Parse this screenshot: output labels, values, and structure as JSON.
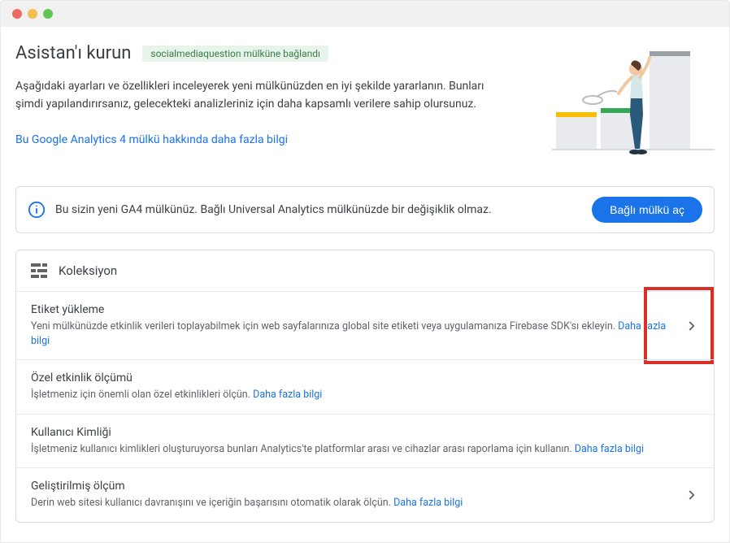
{
  "header": {
    "title": "Asistan'ı kurun",
    "chip": "socialmediaquestion mülküne bağlandı",
    "intro": "Aşağıdaki ayarları ve özellikleri inceleyerek yeni mülkünüzden en iyi şekilde yararlanın. Bunları şimdi yapılandırırsanız, gelecekteki analizleriniz için daha kapsamlı verilere sahip olursunuz.",
    "learn_more": "Bu Google Analytics 4 mülkü hakkında daha fazla bilgi"
  },
  "alert": {
    "text": "Bu sizin yeni GA4 mülkünüz. Bağlı Universal Analytics mülkünüzde bir değişiklik olmaz.",
    "button": "Bağlı mülkü aç"
  },
  "card": {
    "title": "Koleksiyon"
  },
  "items": [
    {
      "title": "Etiket yükleme",
      "desc": "Yeni mülkünüzde etkinlik verileri toplayabilmek için web sayfalarınıza global site etiketi veya uygulamanıza Firebase SDK'sı ekleyin.",
      "more": "Daha fazla bilgi",
      "arrow": true,
      "highlight": true
    },
    {
      "title": "Özel etkinlik ölçümü",
      "desc": "İşletmeniz için önemli olan özel etkinlikleri ölçün.",
      "more": "Daha fazla bilgi",
      "arrow": false,
      "highlight": false
    },
    {
      "title": "Kullanıcı Kimliği",
      "desc": "İşletmeniz kullanıcı kimlikleri oluşturuyorsa bunları Analytics'te platformlar arası ve cihazlar arası raporlama için kullanın.",
      "more": "Daha fazla bilgi",
      "arrow": false,
      "highlight": false
    },
    {
      "title": "Geliştirilmiş ölçüm",
      "desc": "Derin web sitesi kullanıcı davranışını ve içeriğin başarısını otomatik olarak ölçün.",
      "more": "Daha fazla bilgi",
      "arrow": true,
      "highlight": false
    }
  ]
}
